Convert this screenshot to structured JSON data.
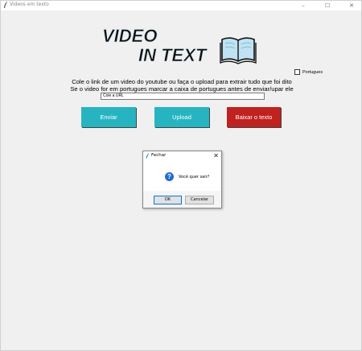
{
  "window": {
    "title": "Videos em texto",
    "controls": {
      "minimize": "–",
      "maximize": "☐",
      "close": "✕"
    }
  },
  "logo": {
    "line1": "VIDEO",
    "line2": "IN TEXT"
  },
  "portuguese_checkbox": {
    "label": "Portugues",
    "checked": false
  },
  "instructions": {
    "line1": "Cole o link de um video do youtube ou faça o upload para extrair tudo que foi dito",
    "line2": "Se o video for em portugues marcar a caixa de portugues antes de enviar/upar ele"
  },
  "url_input": {
    "value": "Cole a URL"
  },
  "buttons": {
    "send": {
      "label": "Enviar",
      "color": "#26b5c0"
    },
    "upload": {
      "label": "Upload",
      "color": "#26b5c0"
    },
    "download": {
      "label": "Baixar o texto",
      "color": "#c0221f"
    }
  },
  "dialog": {
    "title": "Fechar",
    "close": "✕",
    "icon": "question-icon",
    "message": "Você quer sair?",
    "ok_label": "OK",
    "cancel_label": "Cancelar"
  }
}
